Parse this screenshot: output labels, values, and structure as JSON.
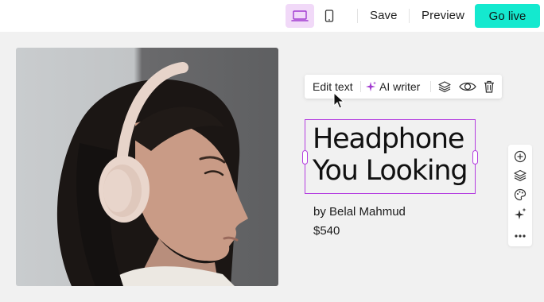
{
  "topbar": {
    "devices": [
      {
        "name": "desktop",
        "icon": "laptop-icon",
        "active": true
      },
      {
        "name": "mobile",
        "icon": "smartphone-icon",
        "active": false
      }
    ],
    "save_label": "Save",
    "preview_label": "Preview",
    "golive_label": "Go live"
  },
  "colors": {
    "accent": "#14e9cf",
    "selection": "#b43ee0",
    "device_active_bg": "#f1d9f8",
    "canvas_bg": "#f1f1f1"
  },
  "floating_toolbar": {
    "edit_text_label": "Edit text",
    "ai_writer_label": "AI writer",
    "icons": [
      "sparkle-icon",
      "layers-icon",
      "eye-icon",
      "trash-icon"
    ]
  },
  "product": {
    "image_icon": "headphone-model-photo",
    "title": "Headphone\nYou Looking",
    "author": "by Belal Mahmud",
    "price": "$540"
  },
  "side_toolbar": {
    "icons": [
      "plus-circle-icon",
      "layers-icon",
      "palette-icon",
      "sparkle-icon",
      "more-icon"
    ]
  }
}
